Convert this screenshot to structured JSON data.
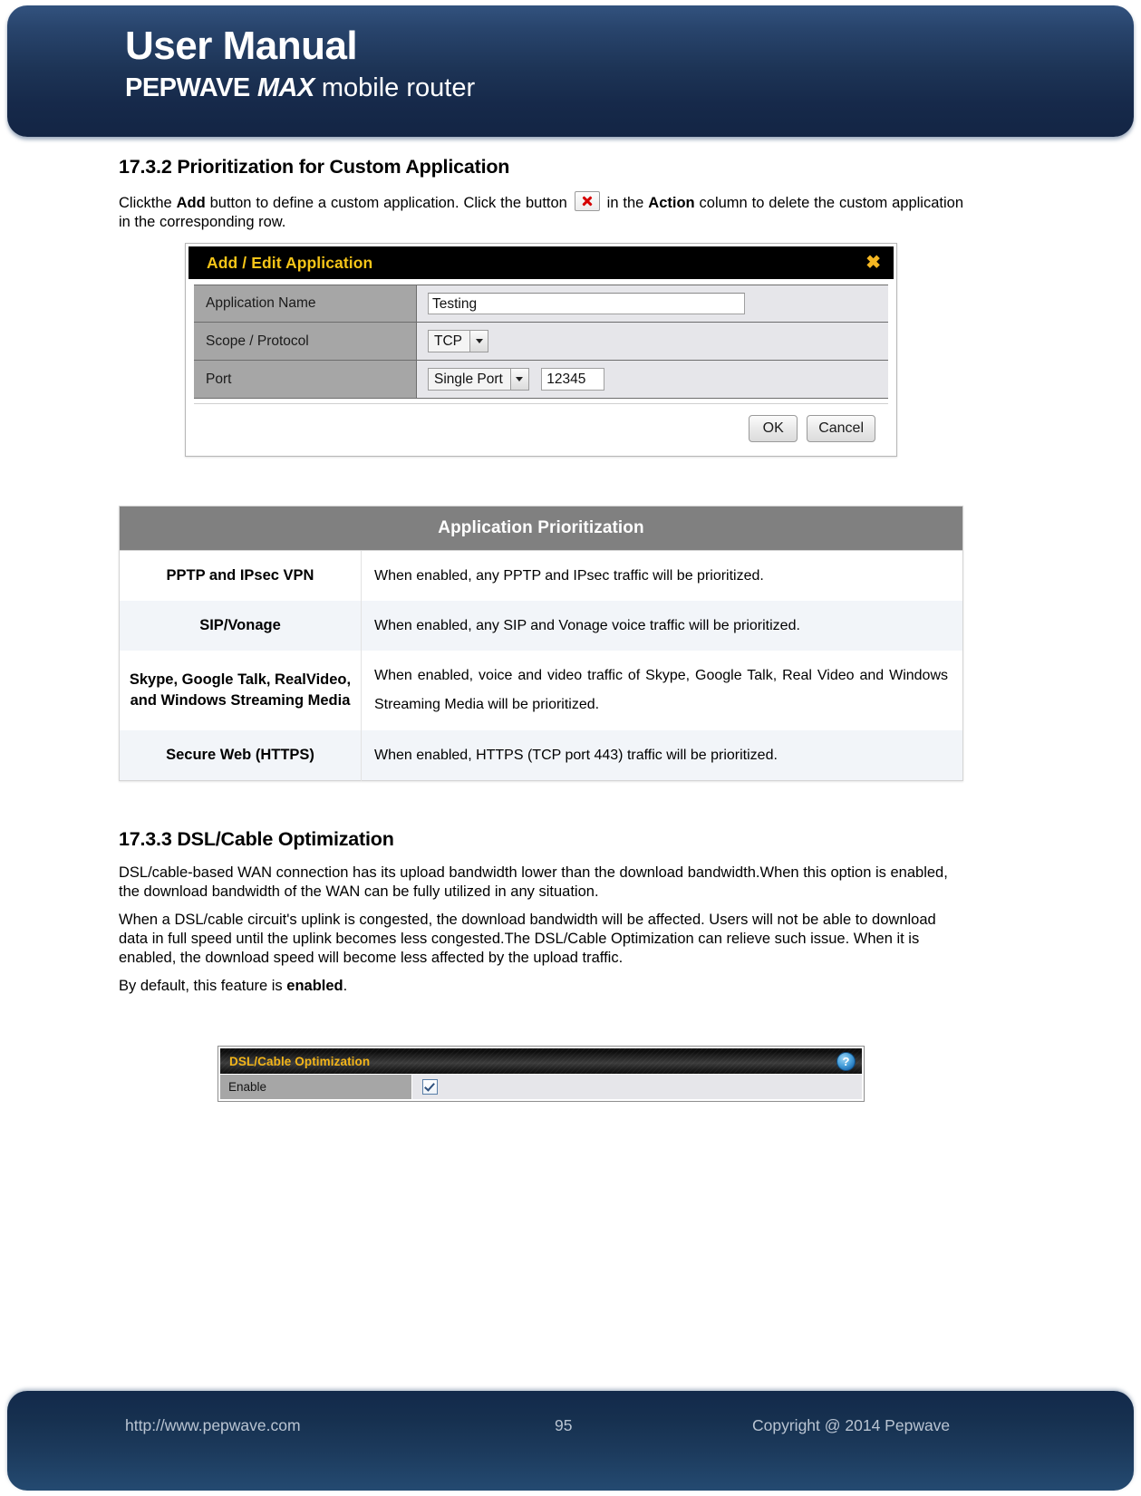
{
  "header": {
    "title": "User Manual",
    "brand": "PEPWAVE",
    "model": "MAX",
    "tagline": "mobile router"
  },
  "sections": {
    "s1732": {
      "heading": "17.3.2 Prioritization for Custom Application",
      "intro_part1": "Clickthe ",
      "intro_bold1": "Add",
      "intro_part2": " button to define a custom application. Click the button ",
      "intro_part3": " in the ",
      "intro_bold2": "Action",
      "intro_part4": " column to delete the custom application in the corresponding row."
    },
    "s1733": {
      "heading": "17.3.3 DSL/Cable Optimization",
      "para1": "DSL/cable-based WAN connection has its upload bandwidth lower than the download bandwidth.When this option is enabled, the download bandwidth of the WAN can be fully utilized in any situation.",
      "para2": "When a DSL/cable circuit's uplink is congested, the download bandwidth will be affected. Users will not be able to download data in full speed until the uplink becomes less congested.The DSL/Cable Optimization can relieve such issue. When it is enabled, the download speed will become less affected by the upload traffic.",
      "para3_prefix": "By default, this feature is ",
      "para3_bold": "enabled",
      "para3_suffix": "."
    }
  },
  "dialog": {
    "title": "Add / Edit Application",
    "close_label": "✖",
    "rows": {
      "app_name_label": "Application Name",
      "app_name_value": "Testing",
      "scope_label": "Scope / Protocol",
      "scope_value": "TCP",
      "port_label": "Port",
      "port_type_value": "Single Port",
      "port_number_value": "12345"
    },
    "ok_label": "OK",
    "cancel_label": "Cancel"
  },
  "spec_table": {
    "title": "Application Prioritization",
    "rows": [
      {
        "key": "PPTP and IPsec VPN",
        "value": "When enabled, any PPTP and IPsec traffic will be prioritized."
      },
      {
        "key": "SIP/Vonage",
        "value": "When enabled, any SIP and Vonage voice traffic will be prioritized."
      },
      {
        "key": "Skype, Google Talk, RealVideo, and Windows Streaming Media",
        "value": "When enabled, voice and video traffic of Skype, Google Talk, Real Video and Windows Streaming Media will be prioritized."
      },
      {
        "key": "Secure Web (HTTPS)",
        "value": "When enabled, HTTPS (TCP port 443) traffic will be prioritized."
      }
    ]
  },
  "widget": {
    "title": "DSL/Cable Optimization",
    "help_label": "?",
    "enable_label": "Enable",
    "enable_checked": true
  },
  "footer": {
    "url": "http://www.pepwave.com",
    "page_number": "95",
    "copyright": "Copyright @ 2014 Pepwave"
  },
  "colors": {
    "header_blue": "#1d3456",
    "accent_yellow": "#f3b519",
    "table_head_gray": "#808080",
    "row_alt": "#f2f5f9",
    "label_gray": "#a6a6a6",
    "value_gray": "#e6e6ea",
    "delete_red": "#d60000"
  }
}
